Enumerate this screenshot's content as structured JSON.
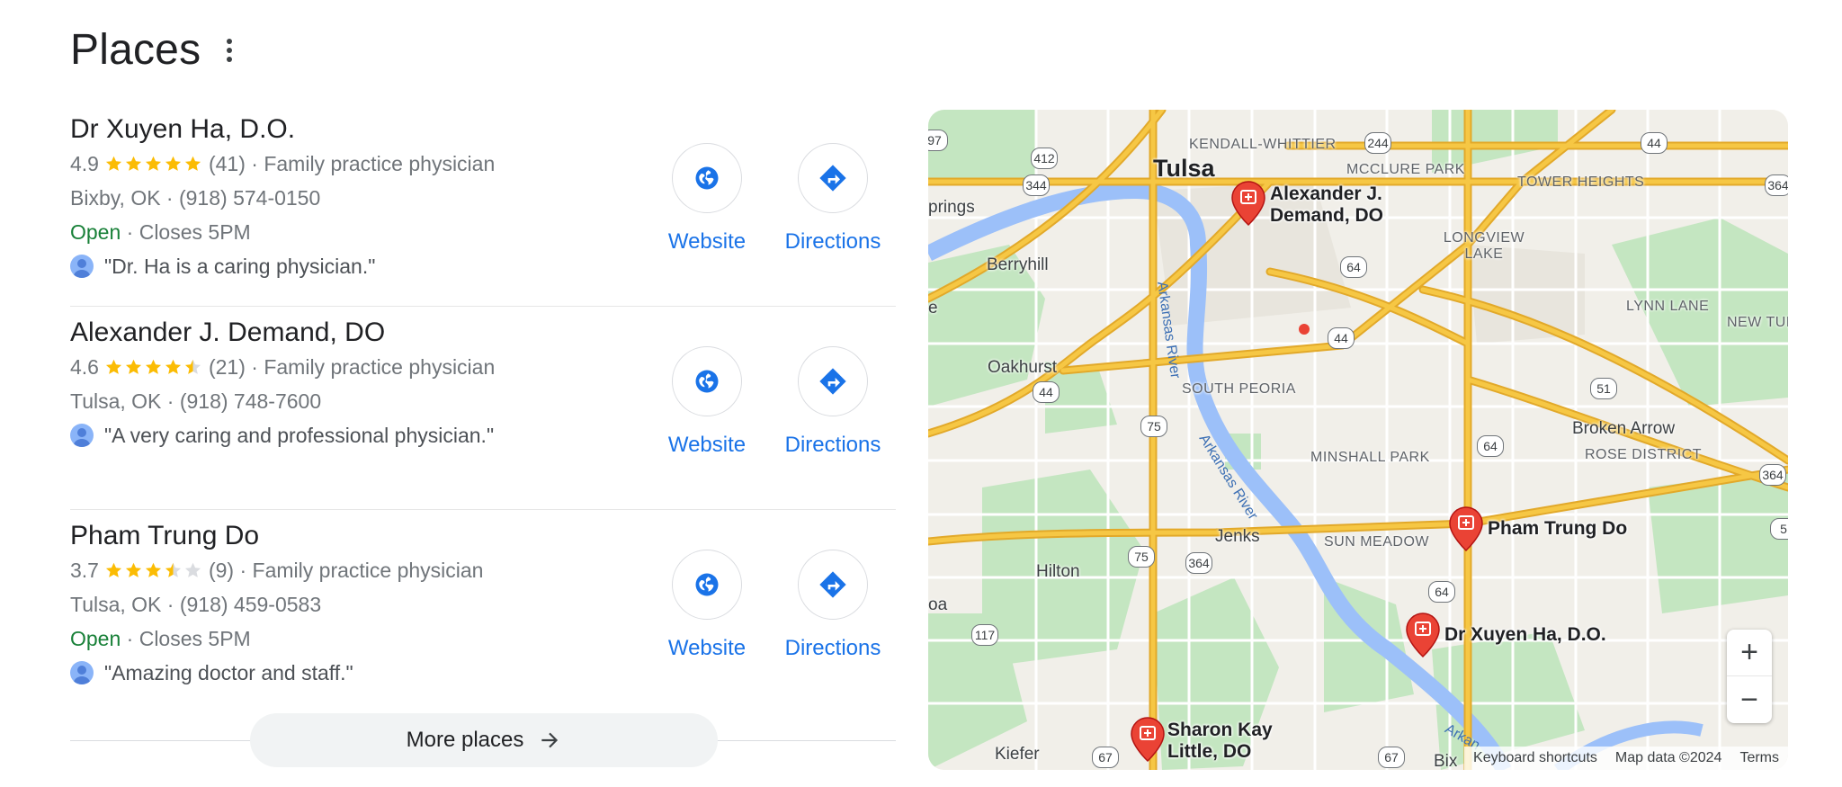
{
  "header": {
    "title": "Places"
  },
  "places": [
    {
      "name": "Dr Xuyen Ha, D.O.",
      "rating": "4.9",
      "stars": 4.9,
      "count": "(41)",
      "category": "· Family practice physician",
      "address": "Bixby, OK · (918) 574-0150",
      "open": "Open",
      "hours": "· Closes 5PM",
      "review": "\"Dr. Ha is a caring physician.\"",
      "website_label": "Website",
      "directions_label": "Directions"
    },
    {
      "name": "Alexander J. Demand, DO",
      "rating": "4.6",
      "stars": 4.6,
      "count": "(21)",
      "category": "· Family practice physician",
      "address": "Tulsa, OK · (918) 748-7600",
      "open": "",
      "hours": "",
      "review": "\"A very caring and professional physician.\"",
      "website_label": "Website",
      "directions_label": "Directions"
    },
    {
      "name": "Pham Trung Do",
      "rating": "3.7",
      "stars": 3.7,
      "count": "(9)",
      "category": "· Family practice physician",
      "address": "Tulsa, OK · (918) 459-0583",
      "open": "Open",
      "hours": "· Closes 5PM",
      "review": "\"Amazing doctor and staff.\"",
      "website_label": "Website",
      "directions_label": "Directions"
    }
  ],
  "more": {
    "label": "More places"
  },
  "map": {
    "big_city": "Tulsa",
    "neighborhoods": [
      "KENDALL-WHITTIER",
      "MCCLURE PARK",
      "TOWER HEIGHTS",
      "LONGVIEW LAKE",
      "LYNN LANE",
      "NEW TUL",
      "SOUTH PEORIA",
      "MINSHALL PARK",
      "ROSE DISTRICT",
      "SUN MEADOW"
    ],
    "cities": [
      "prings",
      "Berryhill",
      "e",
      "Oakhurst",
      "Broken Arrow",
      "Jenks",
      "Hilton",
      "oa",
      "Kiefer",
      "Bix"
    ],
    "rivers": [
      "Arkansas River",
      "Arkansas River",
      "Arkan"
    ],
    "shields": [
      "97",
      "412",
      "344",
      "244",
      "44",
      "364",
      "64",
      "44",
      "44",
      "51",
      "75",
      "64",
      "364",
      "75",
      "364",
      "64",
      "117",
      "67",
      "67",
      "5"
    ],
    "pins": [
      {
        "label": "Alexander J. Demand, DO"
      },
      {
        "label": "Pham Trung Do"
      },
      {
        "label": "Dr Xuyen Ha, D.O."
      },
      {
        "label": "Sharon Kay Little, DO"
      }
    ],
    "zoom_in": "+",
    "zoom_out": "−",
    "attribution": {
      "shortcuts": "Keyboard shortcuts",
      "data": "Map data ©2024",
      "terms": "Terms"
    },
    "colors": {
      "road": "#f6c744",
      "road_edge": "#e2a92a",
      "water": "#9cc0f9",
      "park": "#c4e6c1"
    }
  }
}
